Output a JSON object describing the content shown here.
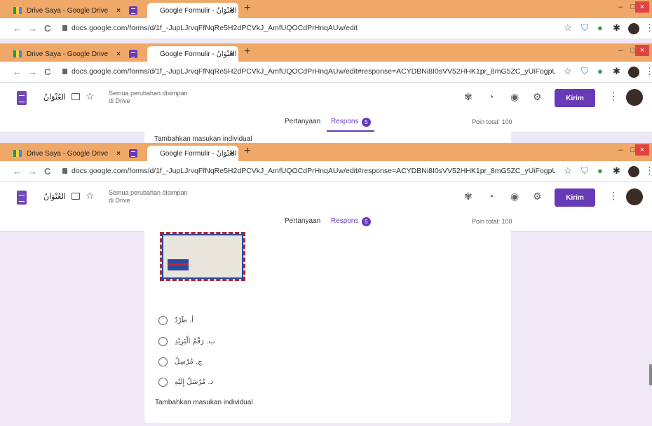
{
  "browser": {
    "tabs": [
      {
        "title": "Drive Saya - Google Drive",
        "close": "×"
      },
      {
        "title": "Google Formulir - العُنْوَانُ",
        "close": "×"
      }
    ],
    "new_tab": "+",
    "window": {
      "minimize": "–",
      "maximize": "□",
      "close": "×"
    },
    "nav": {
      "back": "←",
      "forward": "→",
      "reload": "C"
    },
    "urls": [
      "docs.google.com/forms/d/1f_-JupLJrvqFfNqRe5H2dPCVkJ_AmfUQOCdPrHnqAUw/edit",
      "docs.google.com/forms/d/1f_-JupLJrvqFfNqRe5H2dPCVkJ_AmfUQOCdPrHnqAUw/edit#response=ACYDBNi8I0sVV52HHK1pr_8mG5ZC_yUiFogpUJ23Irs7B23CF6qr...",
      "docs.google.com/forms/d/1f_-JupLJrvqFfNqRe5H2dPCVkJ_AmfUQOCdPrHnqAUw/edit#response=ACYDBNi8I0sVV52HHK1pr_8mG5ZC_yUiFogpUJ23Irs7B23CF6qr..."
    ]
  },
  "form": {
    "name": "العُنْوَانُ",
    "saved_line1": "Semua perubahan disimpan",
    "saved_line2": "di Drive",
    "send_button": "Kirim",
    "more": "⋮",
    "tabs": {
      "questions": "Pertanyaan",
      "responses": "Respons",
      "response_count": "5"
    },
    "points": "Poin total: 100",
    "add_individual": "Tambahkan masukan individual",
    "options": [
      "أ. طَرْدٌ",
      "ب. رَقْمُ الْبَرِيْدِ",
      "ج. مُرْسِلٌ",
      "د. مُرْسَلٌ إِلَيْهِ"
    ]
  },
  "colors": {
    "accent": "#673ab7",
    "chrome_tabbar": "#f0a868",
    "page_bg": "#ede7f6"
  }
}
